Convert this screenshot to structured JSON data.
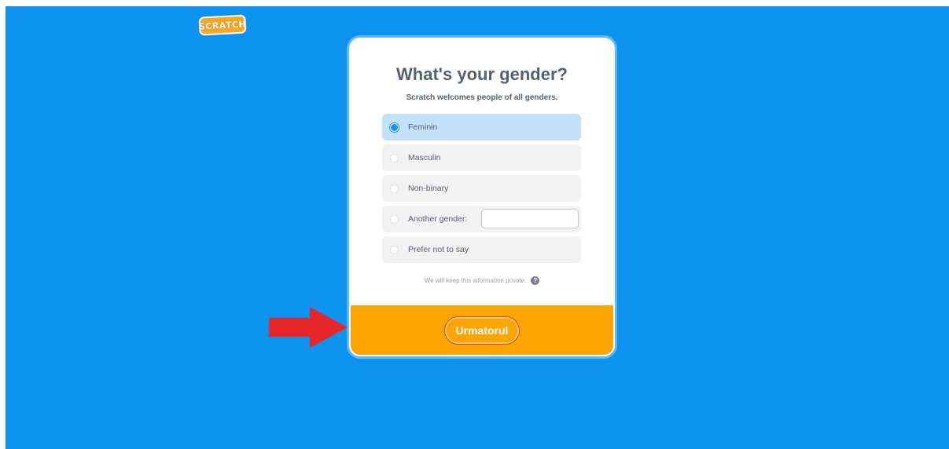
{
  "logo": {
    "text": "SCRATCH"
  },
  "dialog": {
    "title": "What's your gender?",
    "subtitle": "Scratch welcomes people of all genders.",
    "options": [
      {
        "label": "Feminin",
        "selected": true
      },
      {
        "label": "Masculin",
        "selected": false
      },
      {
        "label": "Non-binary",
        "selected": false
      },
      {
        "label": "Another gender:",
        "selected": false
      },
      {
        "label": "Prefer not to say",
        "selected": false
      }
    ],
    "other_gender_value": "",
    "privacy_note": "We will keep this information private.",
    "help_icon": "?",
    "next_button_label": "Urmatorul"
  },
  "annotation": {
    "arrow_icon": "red-right-arrow",
    "arrow_color": "#e8262a"
  },
  "colors": {
    "background": "#0c93f0",
    "footer": "#fca500",
    "selected_option": "#c2e2f9",
    "text": "#575e75"
  }
}
